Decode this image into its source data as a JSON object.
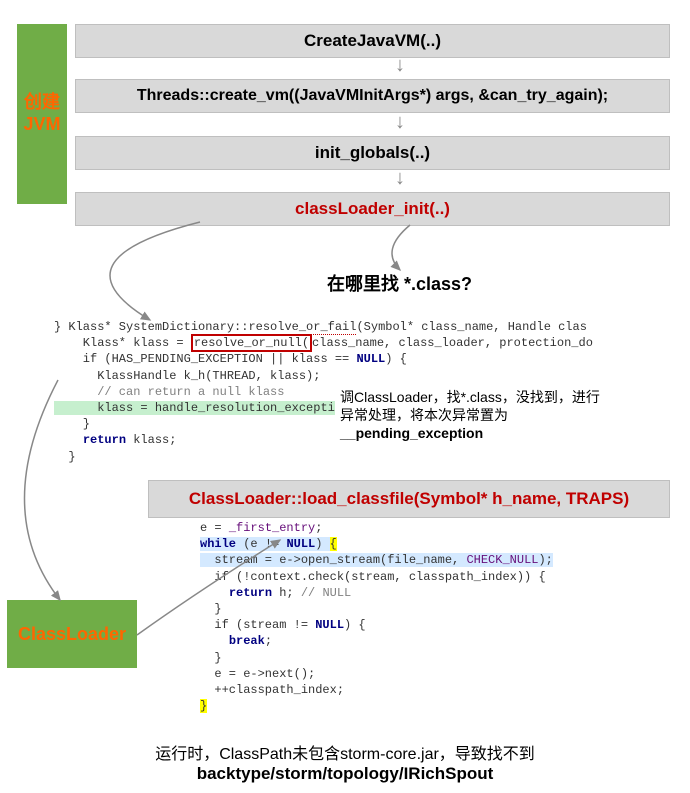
{
  "jvm_label": "创建\nJVM",
  "classloader_label": "ClassLoader",
  "steps": {
    "s1": "CreateJavaVM(..)",
    "s2": "Threads::create_vm((JavaVMInitArgs*) args, &can_try_again);",
    "s3": "init_globals(..)",
    "s4": "classLoader_init(..)",
    "s5": "ClassLoader::load_classfile(Symbol* h_name, TRAPS)"
  },
  "question": "在哪里找 *.class?",
  "code1": {
    "l1a": "} Klass* SystemDictionary::",
    "l1boxed": "resolve_or_fail",
    "l1b": "(Symbol* class_name, Handle clas",
    "l2a": "    Klass* klass = ",
    "l2boxed": "resolve_or_null(",
    "l2b": "class_name, class_loader, protection_do",
    "l3a": "    if (HAS_PENDING_EXCEPTION || klass == ",
    "l3null": "NULL",
    "l3b": ") {",
    "l4": "      KlassHandle k_h(THREAD, klass);",
    "l5": "      // can return a null klass",
    "l6": "      klass = handle_resolution_excepti",
    "l7": "    }",
    "l8a": "    ",
    "l8kw": "return",
    "l8b": " klass;",
    "l9": "  }"
  },
  "annotation": {
    "line1": "调ClassLoader，找*.class，没找到，进行",
    "line2": "异常处理，将本次异常置为",
    "line3": "__pending_exception"
  },
  "code2": {
    "l1a": "e = ",
    "l1b": "_first_entry",
    "l1c": ";",
    "l2a": "while",
    "l2b": " (e != ",
    "l2null": "NULL",
    "l2c": ") ",
    "l2brace": "{",
    "l3a": "  stream = e->open_stream(file_name, ",
    "l3macro": "CHECK_NULL",
    "l3b": ");",
    "l4a": "  if (!context.check(stream, classpath_index)) {",
    "l5a": "    ",
    "l5kw": "return",
    "l5b": " h; ",
    "l5cmt": "// NULL",
    "l6": "  }",
    "l7a": "  if (stream != ",
    "l7null": "NULL",
    "l7b": ") {",
    "l8a": "    ",
    "l8kw": "break",
    "l8b": ";",
    "l9": "  }",
    "l10": "  e = e->next();",
    "l11": "  ++classpath_index;",
    "l12": "}"
  },
  "bottom": {
    "line1": "运行时，ClassPath未包含storm-core.jar，导致找不到",
    "line2": "backtype/storm/topology/IRichSpout"
  }
}
